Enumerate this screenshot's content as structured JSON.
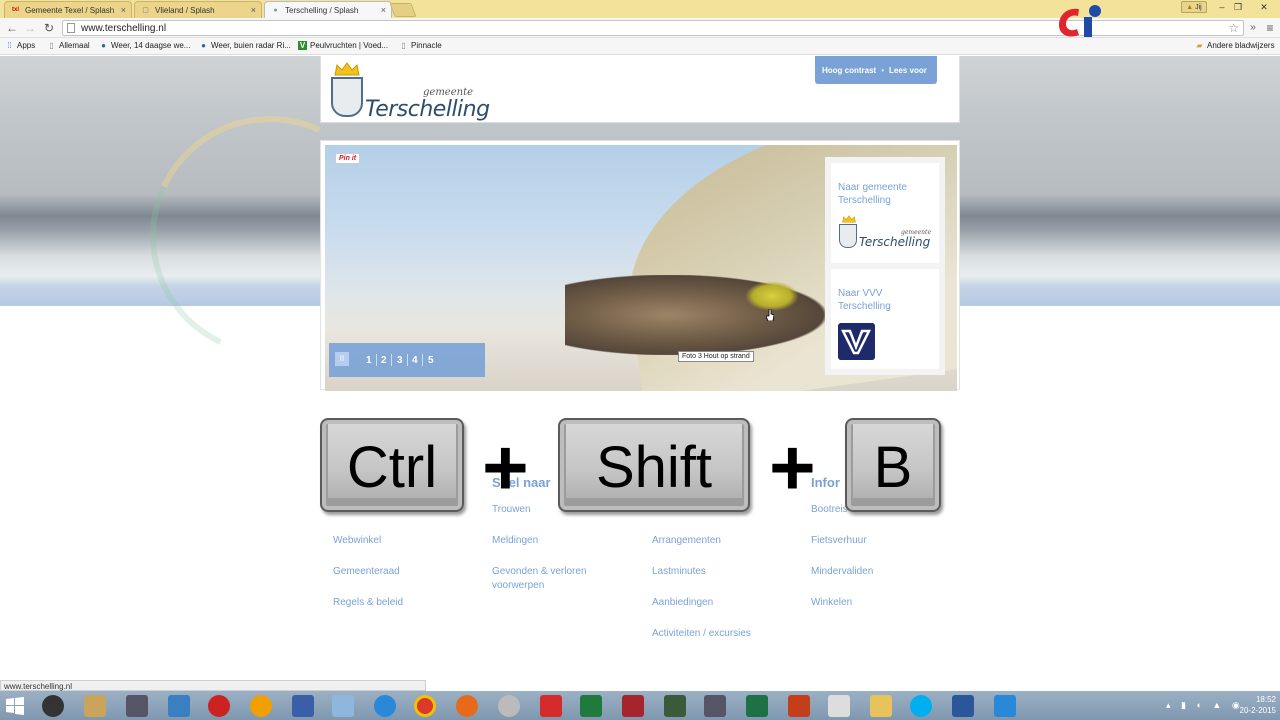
{
  "browser": {
    "tabs": [
      {
        "title": "Gemeente Texel / Splash",
        "favicon": "txl",
        "active": false
      },
      {
        "title": "Vlieland / Splash",
        "favicon": "page",
        "active": false
      },
      {
        "title": "Terschelling / Splash",
        "favicon": "bulb",
        "active": true
      }
    ],
    "profile_badge": "Jij",
    "window_controls": {
      "minimize": "–",
      "restore": "❐",
      "close": "✕"
    },
    "url": "www.terschelling.nl",
    "bookmarks": [
      {
        "label": "Apps",
        "icon": "apps-grid-icon"
      },
      {
        "label": "Allemaal",
        "icon": "doc-icon"
      },
      {
        "label": "Weer, 14 daagse we...",
        "icon": "globe-icon"
      },
      {
        "label": "Weer, buien radar Ri...",
        "icon": "globe-icon"
      },
      {
        "label": "Peulvruchten | Voed...",
        "icon": "v-icon"
      },
      {
        "label": "Pinnacle",
        "icon": "doc-icon"
      }
    ],
    "other_bookmarks": "Andere bladwijzers",
    "status_url": "www.terschelling.nl"
  },
  "site": {
    "logo_small": "gemeente",
    "logo_main": "Terschelling",
    "accessibility": {
      "contrast": "Hoog contrast",
      "read_aloud": "Lees voor"
    },
    "pin_it": "Pin it",
    "slider": {
      "pause": "II",
      "slides": [
        "1",
        "2",
        "3",
        "4",
        "5"
      ],
      "caption": "Foto 3 Hout op strand"
    },
    "side_cards": [
      {
        "title": "Naar gemeente Terschelling",
        "logo": "terschelling-logo"
      },
      {
        "title": "Naar VVV Terschelling",
        "logo": "vvv-logo"
      }
    ],
    "link_columns": [
      {
        "heading": "",
        "links": [
          "",
          "Webwinkel",
          "Gemeenteraad",
          "Regels & beleid"
        ]
      },
      {
        "heading": "Snel naar",
        "links": [
          "Trouwen",
          "Meldingen",
          "Gevonden & verloren voorwerpen"
        ]
      },
      {
        "heading": "",
        "links": [
          "",
          "Arrangementen",
          "Lastminutes",
          "Aanbiedingen",
          "Activiteiten / excursies"
        ]
      },
      {
        "heading": "Infor",
        "links": [
          "Bootreis",
          "Fietsverhuur",
          "Mindervaliden",
          "Winkelen"
        ]
      }
    ]
  },
  "overlay": {
    "keys": [
      "Ctrl",
      "Shift",
      "B"
    ],
    "plus": "+",
    "watermark": "ci"
  },
  "taskbar": {
    "clock_time": "18:52",
    "clock_date": "20-2-2015"
  },
  "colors": {
    "accent": "#7aa2d6",
    "logo_blue": "#2c4e6c",
    "tab_strip": "#f3e39a",
    "taskbar": "#8aa2ba"
  }
}
